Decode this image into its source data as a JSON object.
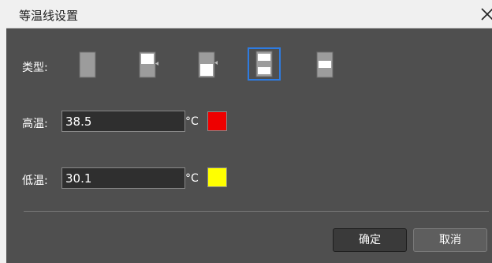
{
  "window": {
    "title": "等温线设置"
  },
  "type_row": {
    "label": "类型:",
    "options": [
      {
        "icon": "isotherm-type-full-bar-icon",
        "selected": false
      },
      {
        "icon": "isotherm-type-top-white-arrow-icon",
        "selected": false
      },
      {
        "icon": "isotherm-type-bottom-white-arrow-icon",
        "selected": false
      },
      {
        "icon": "isotherm-type-split-white-icon",
        "selected": true
      },
      {
        "icon": "isotherm-type-middle-band-icon",
        "selected": false
      }
    ]
  },
  "high_temp": {
    "label": "高温:",
    "value": "38.5",
    "unit": "°C",
    "color": "#ee0000"
  },
  "low_temp": {
    "label": "低温:",
    "value": "30.1",
    "unit": "°C",
    "color": "#ffff00"
  },
  "buttons": {
    "ok": "确定",
    "cancel": "取消"
  },
  "colors": {
    "selection_border": "#2e7be0",
    "background": "#4f4f4f"
  }
}
